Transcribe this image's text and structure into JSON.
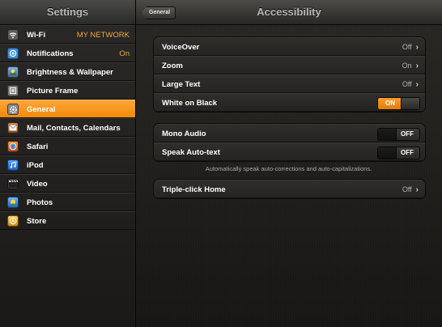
{
  "sidebar": {
    "title": "Settings",
    "items": [
      {
        "label": "Wi-Fi",
        "value": "MY NETWORK",
        "icon": "wifi-icon",
        "icon_color": "#5d5d5d"
      },
      {
        "label": "Notifications",
        "value": "On",
        "icon": "notifications-icon",
        "icon_color": "#3a8fd8"
      },
      {
        "label": "Brightness & Wallpaper",
        "value": "",
        "icon": "brightness-icon",
        "icon_color": "#6b87a8"
      },
      {
        "label": "Picture Frame",
        "value": "",
        "icon": "picture-frame-icon",
        "icon_color": "#7a7a7a"
      },
      {
        "label": "General",
        "value": "",
        "icon": "gear-icon",
        "icon_color": "#8a8a8a",
        "active": true
      },
      {
        "label": "Mail, Contacts, Calendars",
        "value": "",
        "icon": "mail-icon",
        "icon_color": "#9a6a3a"
      },
      {
        "label": "Safari",
        "value": "",
        "icon": "safari-icon",
        "icon_color": "#d6692a"
      },
      {
        "label": "iPod",
        "value": "",
        "icon": "ipod-icon",
        "icon_color": "#2f7fd8"
      },
      {
        "label": "Video",
        "value": "",
        "icon": "video-icon",
        "icon_color": "#404040"
      },
      {
        "label": "Photos",
        "value": "",
        "icon": "photos-icon",
        "icon_color": "#e3b52a"
      },
      {
        "label": "Store",
        "value": "",
        "icon": "store-icon",
        "icon_color": "#c9a03a"
      }
    ]
  },
  "navbar": {
    "back_label": "General",
    "title": "Accessibility"
  },
  "groups": {
    "vision": [
      {
        "label": "VoiceOver",
        "value": "Off"
      },
      {
        "label": "Zoom",
        "value": "On"
      },
      {
        "label": "Large Text",
        "value": "Off"
      },
      {
        "label": "White on Black",
        "toggle": "ON"
      }
    ],
    "audio": [
      {
        "label": "Mono Audio",
        "toggle": "OFF"
      },
      {
        "label": "Speak Auto-text",
        "toggle": "OFF"
      }
    ],
    "audio_footnote": "Automatically speak auto-corrections and auto-capitalizations.",
    "home": [
      {
        "label": "Triple-click Home",
        "value": "Off"
      }
    ]
  },
  "colors": {
    "accent": "#f2890a",
    "value_orange": "#f0a73a"
  }
}
